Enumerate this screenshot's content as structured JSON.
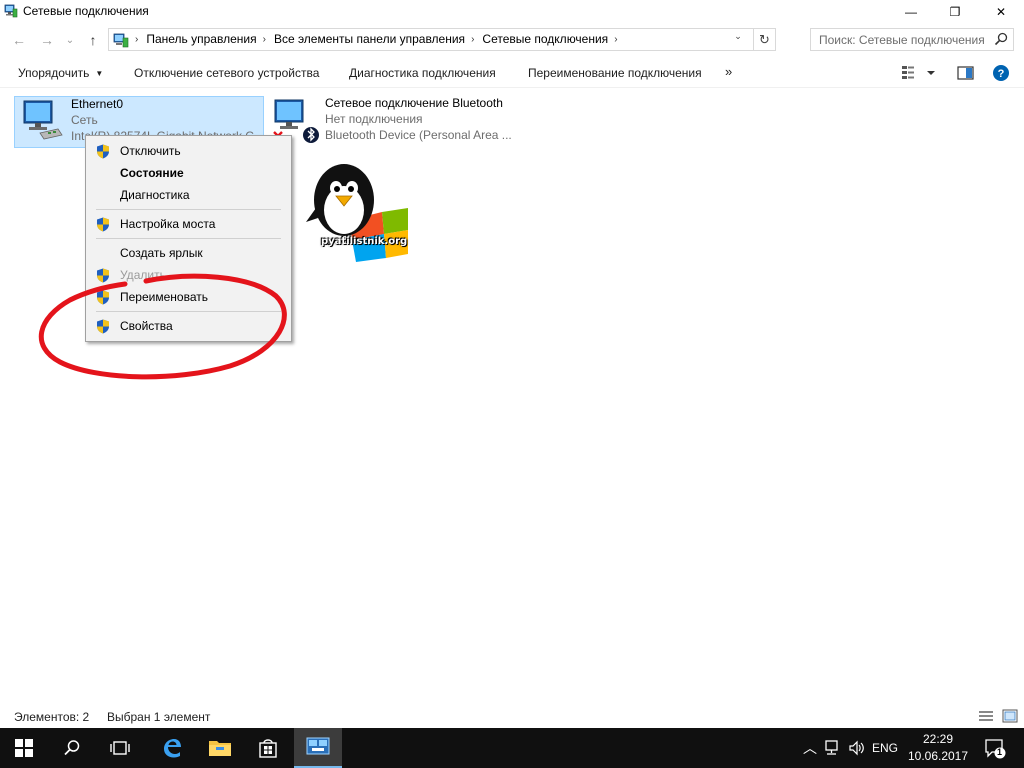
{
  "window": {
    "title": "Сетевые подключения",
    "minimize_glyph": "—",
    "maximize_glyph": "❐",
    "close_glyph": "✕"
  },
  "nav": {
    "back_glyph": "←",
    "forward_glyph": "→",
    "recent_glyph": "⌄",
    "up_glyph": "↑",
    "breadcrumbs": [
      "Панель управления",
      "Все элементы панели управления",
      "Сетевые подключения"
    ],
    "crumb_separator": "›",
    "dropdown_glyph": "⌄",
    "refresh_glyph": "↻",
    "search_placeholder": "Поиск: Сетевые подключения"
  },
  "commandbar": {
    "organize": "Упорядочить",
    "disable": "Отключение сетевого устройства",
    "diagnose": "Диагностика подключения",
    "rename": "Переименование подключения",
    "more": "»"
  },
  "items": [
    {
      "name": "Ethernet0",
      "status": "Сеть",
      "device": "Intel(R) 82574L Gigabit Network C...",
      "selected": true
    },
    {
      "name": "Сетевое подключение Bluetooth",
      "status": "Нет подключения",
      "device": "Bluetooth Device (Personal Area ...",
      "selected": false
    }
  ],
  "context_menu": {
    "items": [
      {
        "label": "Отключить",
        "shield": true,
        "bold": false,
        "disabled": false
      },
      {
        "label": "Состояние",
        "shield": false,
        "bold": true,
        "disabled": false
      },
      {
        "label": "Диагностика",
        "shield": false,
        "bold": false,
        "disabled": false
      },
      {
        "label": "Настройка моста",
        "shield": true,
        "bold": false,
        "disabled": false
      },
      {
        "label": "Создать ярлык",
        "shield": false,
        "bold": false,
        "disabled": false
      },
      {
        "label": "Удалить",
        "shield": true,
        "bold": false,
        "disabled": true
      },
      {
        "label": "Переименовать",
        "shield": true,
        "bold": false,
        "disabled": false
      },
      {
        "label": "Свойства",
        "shield": true,
        "bold": false,
        "disabled": false
      }
    ],
    "highlight_color": "#e4141b"
  },
  "watermark": {
    "text": "pyatilistnik.org"
  },
  "statusbar": {
    "count": "Элементов: 2",
    "selected": "Выбран 1 элемент"
  },
  "taskbar": {
    "language": "ENG",
    "time": "22:29",
    "date": "10.06.2017",
    "notification_count": "1",
    "tray_chevron": "︿"
  },
  "colors": {
    "selection_bg": "#cce8ff",
    "selection_border": "#99d1ff",
    "taskbar_bg": "#101010",
    "accent": "#0078d7"
  }
}
